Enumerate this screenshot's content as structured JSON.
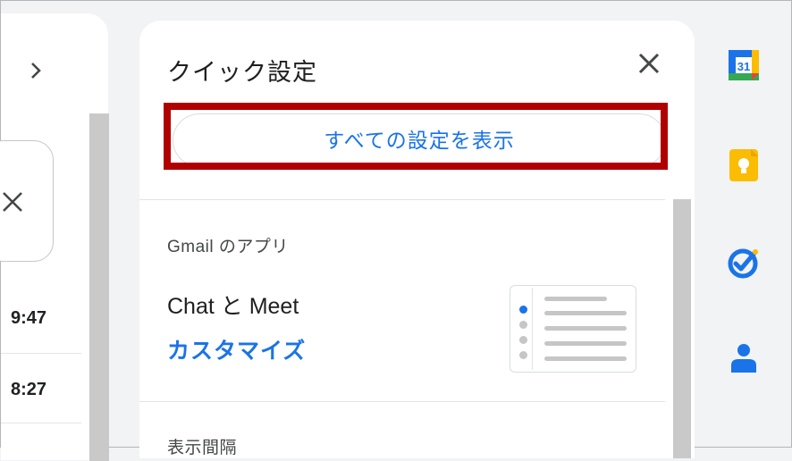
{
  "left_pane": {
    "rows": [
      {
        "time": "9:47"
      },
      {
        "time": "8:27"
      }
    ]
  },
  "quick_settings": {
    "title": "クイック設定",
    "all_settings_label": "すべての設定を表示",
    "apps_section_label": "Gmail のアプリ",
    "chat_meet_label": "Chat と Meet",
    "customize_label": "カスタマイズ",
    "density_section_label": "表示間隔"
  },
  "side_panel": {
    "calendar_day": "31",
    "icons": [
      "calendar-icon",
      "keep-icon",
      "tasks-icon",
      "contacts-icon"
    ]
  },
  "colors": {
    "accent_blue": "#1a73e8",
    "highlight_red": "#b00000",
    "keep_yellow": "#fbbc04"
  }
}
